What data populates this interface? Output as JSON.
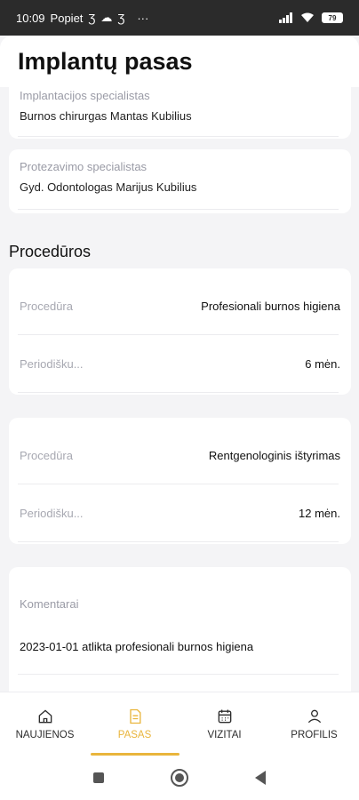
{
  "status_bar": {
    "time": "10:09",
    "day_period": "Popiet",
    "battery": "79"
  },
  "header": {
    "title": "Implantų pasas"
  },
  "specialists": [
    {
      "label": "Implantacijos specialistas",
      "value": "Burnos chirurgas  Mantas Kubilius"
    },
    {
      "label": "Protezavimo specialistas",
      "value": "Gyd. Odontologas  Marijus Kubilius"
    }
  ],
  "procedures_section": {
    "title": "Procedūros"
  },
  "procedures": [
    {
      "procedure_label": "Procedūra",
      "procedure_value": "Profesionali burnos higiena",
      "period_label": "Periodišku...",
      "period_value": "6 mėn."
    },
    {
      "procedure_label": "Procedūra",
      "procedure_value": "Rentgenologinis ištyrimas",
      "period_label": "Periodišku...",
      "period_value": "12 mėn."
    }
  ],
  "comments": {
    "label": "Komentarai",
    "text": "2023-01-01 atlikta profesionali burnos higiena"
  },
  "bottom_nav": {
    "items": [
      {
        "label": "NAUJIENOS",
        "icon": "home-icon",
        "active": false
      },
      {
        "label": "PASAS",
        "icon": "document-icon",
        "active": true
      },
      {
        "label": "VIZITAI",
        "icon": "calendar-icon",
        "active": false
      },
      {
        "label": "PROFILIS",
        "icon": "user-icon",
        "active": false
      }
    ]
  },
  "colors": {
    "accent": "#e9b53c",
    "background": "#f4f4f6",
    "card": "#ffffff",
    "muted_text": "#9a9ba6"
  }
}
